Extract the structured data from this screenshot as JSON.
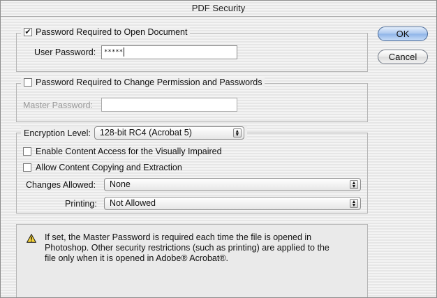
{
  "window": {
    "title": "PDF Security"
  },
  "open_password_group": {
    "checkbox_label": "Password Required to Open Document",
    "checked": true,
    "user_password_label": "User Password:",
    "user_password_value": "*****"
  },
  "permission_group": {
    "checkbox_label": "Password Required to Change Permission and Passwords",
    "checked": false,
    "master_password_label": "Master Password:",
    "master_password_value": ""
  },
  "encryption_group": {
    "level_label": "Encryption Level:",
    "level_value": "128-bit RC4 (Acrobat 5)",
    "visually_impaired_label": "Enable Content Access for the Visually Impaired",
    "visually_impaired_checked": false,
    "copying_label": "Allow Content Copying and Extraction",
    "copying_checked": false,
    "changes_label": "Changes Allowed:",
    "changes_value": "None",
    "printing_label": "Printing:",
    "printing_value": "Not Allowed"
  },
  "buttons": {
    "ok": "OK",
    "cancel": "Cancel"
  },
  "info": {
    "icon": "warning-icon",
    "text": "If set, the Master Password is required each time the file is opened in\nPhotoshop. Other security restrictions (such as printing) are applied to the\nfile only when it is opened in Adobe® Acrobat®."
  },
  "colors": {
    "accent_button": "#a9c6ee",
    "disabled_text": "#9a9a9a"
  }
}
